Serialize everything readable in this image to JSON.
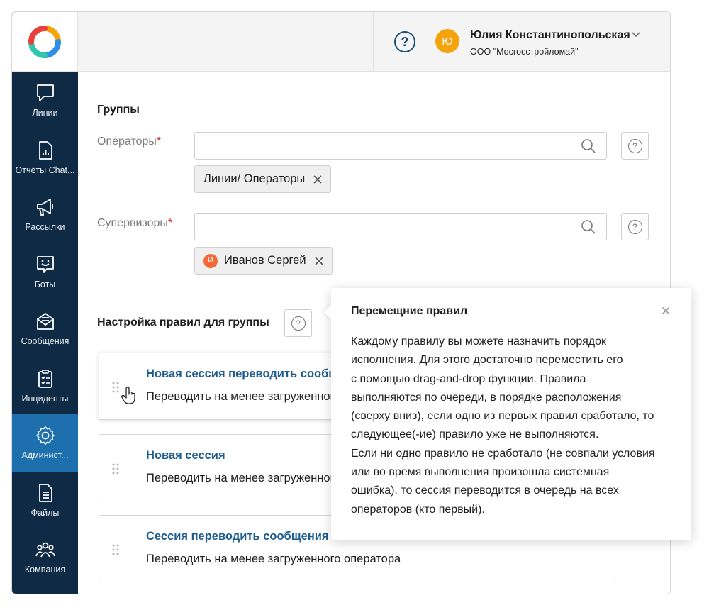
{
  "header": {
    "help_symbol": "?",
    "user_initial": "Ю",
    "user_name": "Юлия Константинопольская",
    "user_org": "ООО \"Мосгосстройломай\""
  },
  "sidebar": {
    "items": [
      {
        "label": "Линии",
        "icon": "chat-bubble-icon"
      },
      {
        "label": "Отчёты Chat...",
        "icon": "report-icon"
      },
      {
        "label": "Рассылки",
        "icon": "megaphone-icon"
      },
      {
        "label": "Боты",
        "icon": "bot-icon"
      },
      {
        "label": "Сообщения",
        "icon": "envelope-icon"
      },
      {
        "label": "Инциденты",
        "icon": "clipboard-icon"
      },
      {
        "label": "Админист...",
        "icon": "gear-icon",
        "active": true
      },
      {
        "label": "Файлы",
        "icon": "file-icon"
      },
      {
        "label": "Компания",
        "icon": "people-icon"
      }
    ]
  },
  "groups": {
    "title": "Группы",
    "operators_label": "Операторы",
    "supervisors_label": "Супервизоры",
    "required_mark": "*",
    "operators_search_value": "",
    "supervisors_search_value": "",
    "operator_tag": "Линии/ Операторы",
    "supervisor_tag": "Иванов Сергей",
    "supervisor_initial": "И"
  },
  "rules": {
    "title": "Настройка правил для группы",
    "items": [
      {
        "title": "Новая сессия переводить сообщения",
        "desc": "Переводить на менее загруженного оператора"
      },
      {
        "title": "Новая сессия",
        "desc": "Переводить на менее загруженного оператора"
      },
      {
        "title": "Сессия переводить сообщения",
        "desc": "Переводить на менее загруженного оператора"
      }
    ]
  },
  "popover": {
    "title": "Перемещние правил",
    "lines": [
      "Каждому правилу вы можете назначить порядок",
      "исполнения. Для этого достаточно переместить его",
      "с помощью drag-and-drop функции. Правила",
      "выполняются по очереди, в порядке расположения",
      "(сверху вниз), если одно из первых правил сработало, то",
      "следующее(-ие) правило уже не выполняются.",
      "Если ни одно правило не сработало (не совпали условия",
      "или во время выполнения произошла системная",
      "ошибка), то сессия переводится в очередь на всех",
      "операторов (кто первый)."
    ]
  },
  "colors": {
    "sidebar_bg": "#0f2a44",
    "sidebar_active": "#1d6fae",
    "link": "#1d5c8e",
    "avatar_user": "#f5a30a",
    "avatar_supervisor": "#f26a35",
    "required": "#e0252b"
  }
}
